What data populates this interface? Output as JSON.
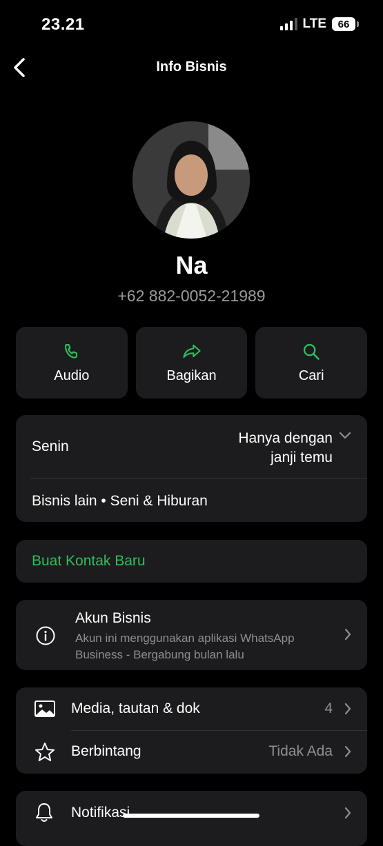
{
  "status": {
    "time": "23.21",
    "network": "LTE",
    "battery": "66"
  },
  "nav": {
    "title": "Info Bisnis"
  },
  "profile": {
    "name": "Na",
    "phone": "+62 882-0052-21989"
  },
  "actions": [
    {
      "label": "Audio",
      "icon": "phone-icon"
    },
    {
      "label": "Bagikan",
      "icon": "share-icon"
    },
    {
      "label": "Cari",
      "icon": "search-icon"
    }
  ],
  "hours": {
    "day": "Senin",
    "status_line1": "Hanya dengan",
    "status_line2": "janji temu"
  },
  "category": "Bisnis lain • Seni & Hiburan",
  "new_contact": "Buat Kontak Baru",
  "business": {
    "title": "Akun Bisnis",
    "description": "Akun ini menggunakan aplikasi WhatsApp Business - Bergabung bulan lalu"
  },
  "media": {
    "label": "Media, tautan & dok",
    "count": "4"
  },
  "starred": {
    "label": "Berbintang",
    "value": "Tidak Ada"
  },
  "notifications": {
    "label": "Notifikasi"
  },
  "colors": {
    "accent": "#2fbf5b",
    "card": "#1c1c1e",
    "background": "#000000"
  }
}
